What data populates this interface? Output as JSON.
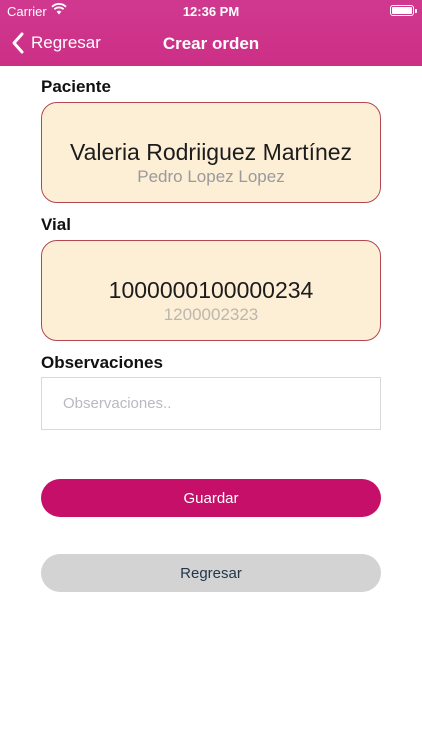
{
  "status_bar": {
    "carrier": "Carrier",
    "time": "12:36 PM",
    "battery_level": 1.0
  },
  "nav": {
    "back_label": "Regresar",
    "title": "Crear orden"
  },
  "paciente": {
    "label": "Paciente",
    "selected": "Valeria Rodriiguez Martínez",
    "next": "Pedro Lopez Lopez"
  },
  "vial": {
    "label": "Vial",
    "selected": "1000000100000234",
    "next": "1200002323"
  },
  "observaciones": {
    "label": "Observaciones",
    "placeholder": "Observaciones..",
    "value": ""
  },
  "buttons": {
    "save": "Guardar",
    "back": "Regresar"
  },
  "colors": {
    "nav_bar": "#cc2f86",
    "picker_bg": "#fdeed6",
    "picker_border": "#b5474f",
    "primary_button": "#c60f68",
    "secondary_button": "#d3d3d3"
  },
  "icons": {
    "wifi": "wifi-icon",
    "battery": "battery-icon",
    "back": "chevron-left-icon"
  }
}
